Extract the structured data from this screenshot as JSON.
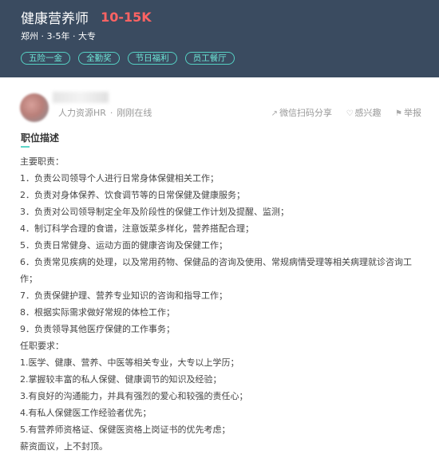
{
  "job": {
    "title": "健康营养师",
    "salary": "10-15K",
    "meta": "郑州 · 3-5年 · 大专",
    "tags": [
      "五险一金",
      "全勤奖",
      "节日福利",
      "员工餐厅"
    ]
  },
  "recruiter": {
    "role": "人力资源HR",
    "separator": "·",
    "status": "刚刚在线"
  },
  "actions": {
    "share": "微信扫码分享",
    "interest": "感兴趣",
    "report": "举报"
  },
  "section": {
    "title": "职位描述"
  },
  "description": [
    "主要职责：",
    "1．负责公司领导个人进行日常身体保健相关工作；",
    "2．负责对身体保养、饮食调节等的日常保健及健康服务；",
    "3．负责对公司领导制定全年及阶段性的保健工作计划及提醒、监测；",
    "4．制订科学合理的食谱，注意饭菜多样化，营养搭配合理；",
    "5．负责日常健身、运动方面的健康咨询及保健工作；",
    "6．负责常见疾病的处理，以及常用药物、保健品的咨询及使用、常规病情受理等相关病理就诊咨询工作；",
    "7．负责保健护理、营养专业知识的咨询和指导工作；",
    "8．根据实际需求做好常规的体检工作；",
    "9．负责领导其他医疗保健的工作事务；",
    "任职要求：",
    "1.医学、健康、营养、中医等相关专业，大专以上学历；",
    "2.掌握较丰富的私人保健、健康调节的知识及经验；",
    "3.有良好的沟通能力，并具有强烈的爱心和较强的责任心；",
    "4.有私人保健医工作经验者优先；",
    "5.有营养师资格证、保健医资格上岗证书的优先考虑；",
    "薪资面议，上不封顶。"
  ],
  "icons": {
    "share": "share-icon",
    "interest": "heart-icon",
    "report": "flag-icon"
  },
  "colors": {
    "header_bg": "#3a4b60",
    "salary": "#ff6363",
    "tag": "#55d1c4"
  }
}
